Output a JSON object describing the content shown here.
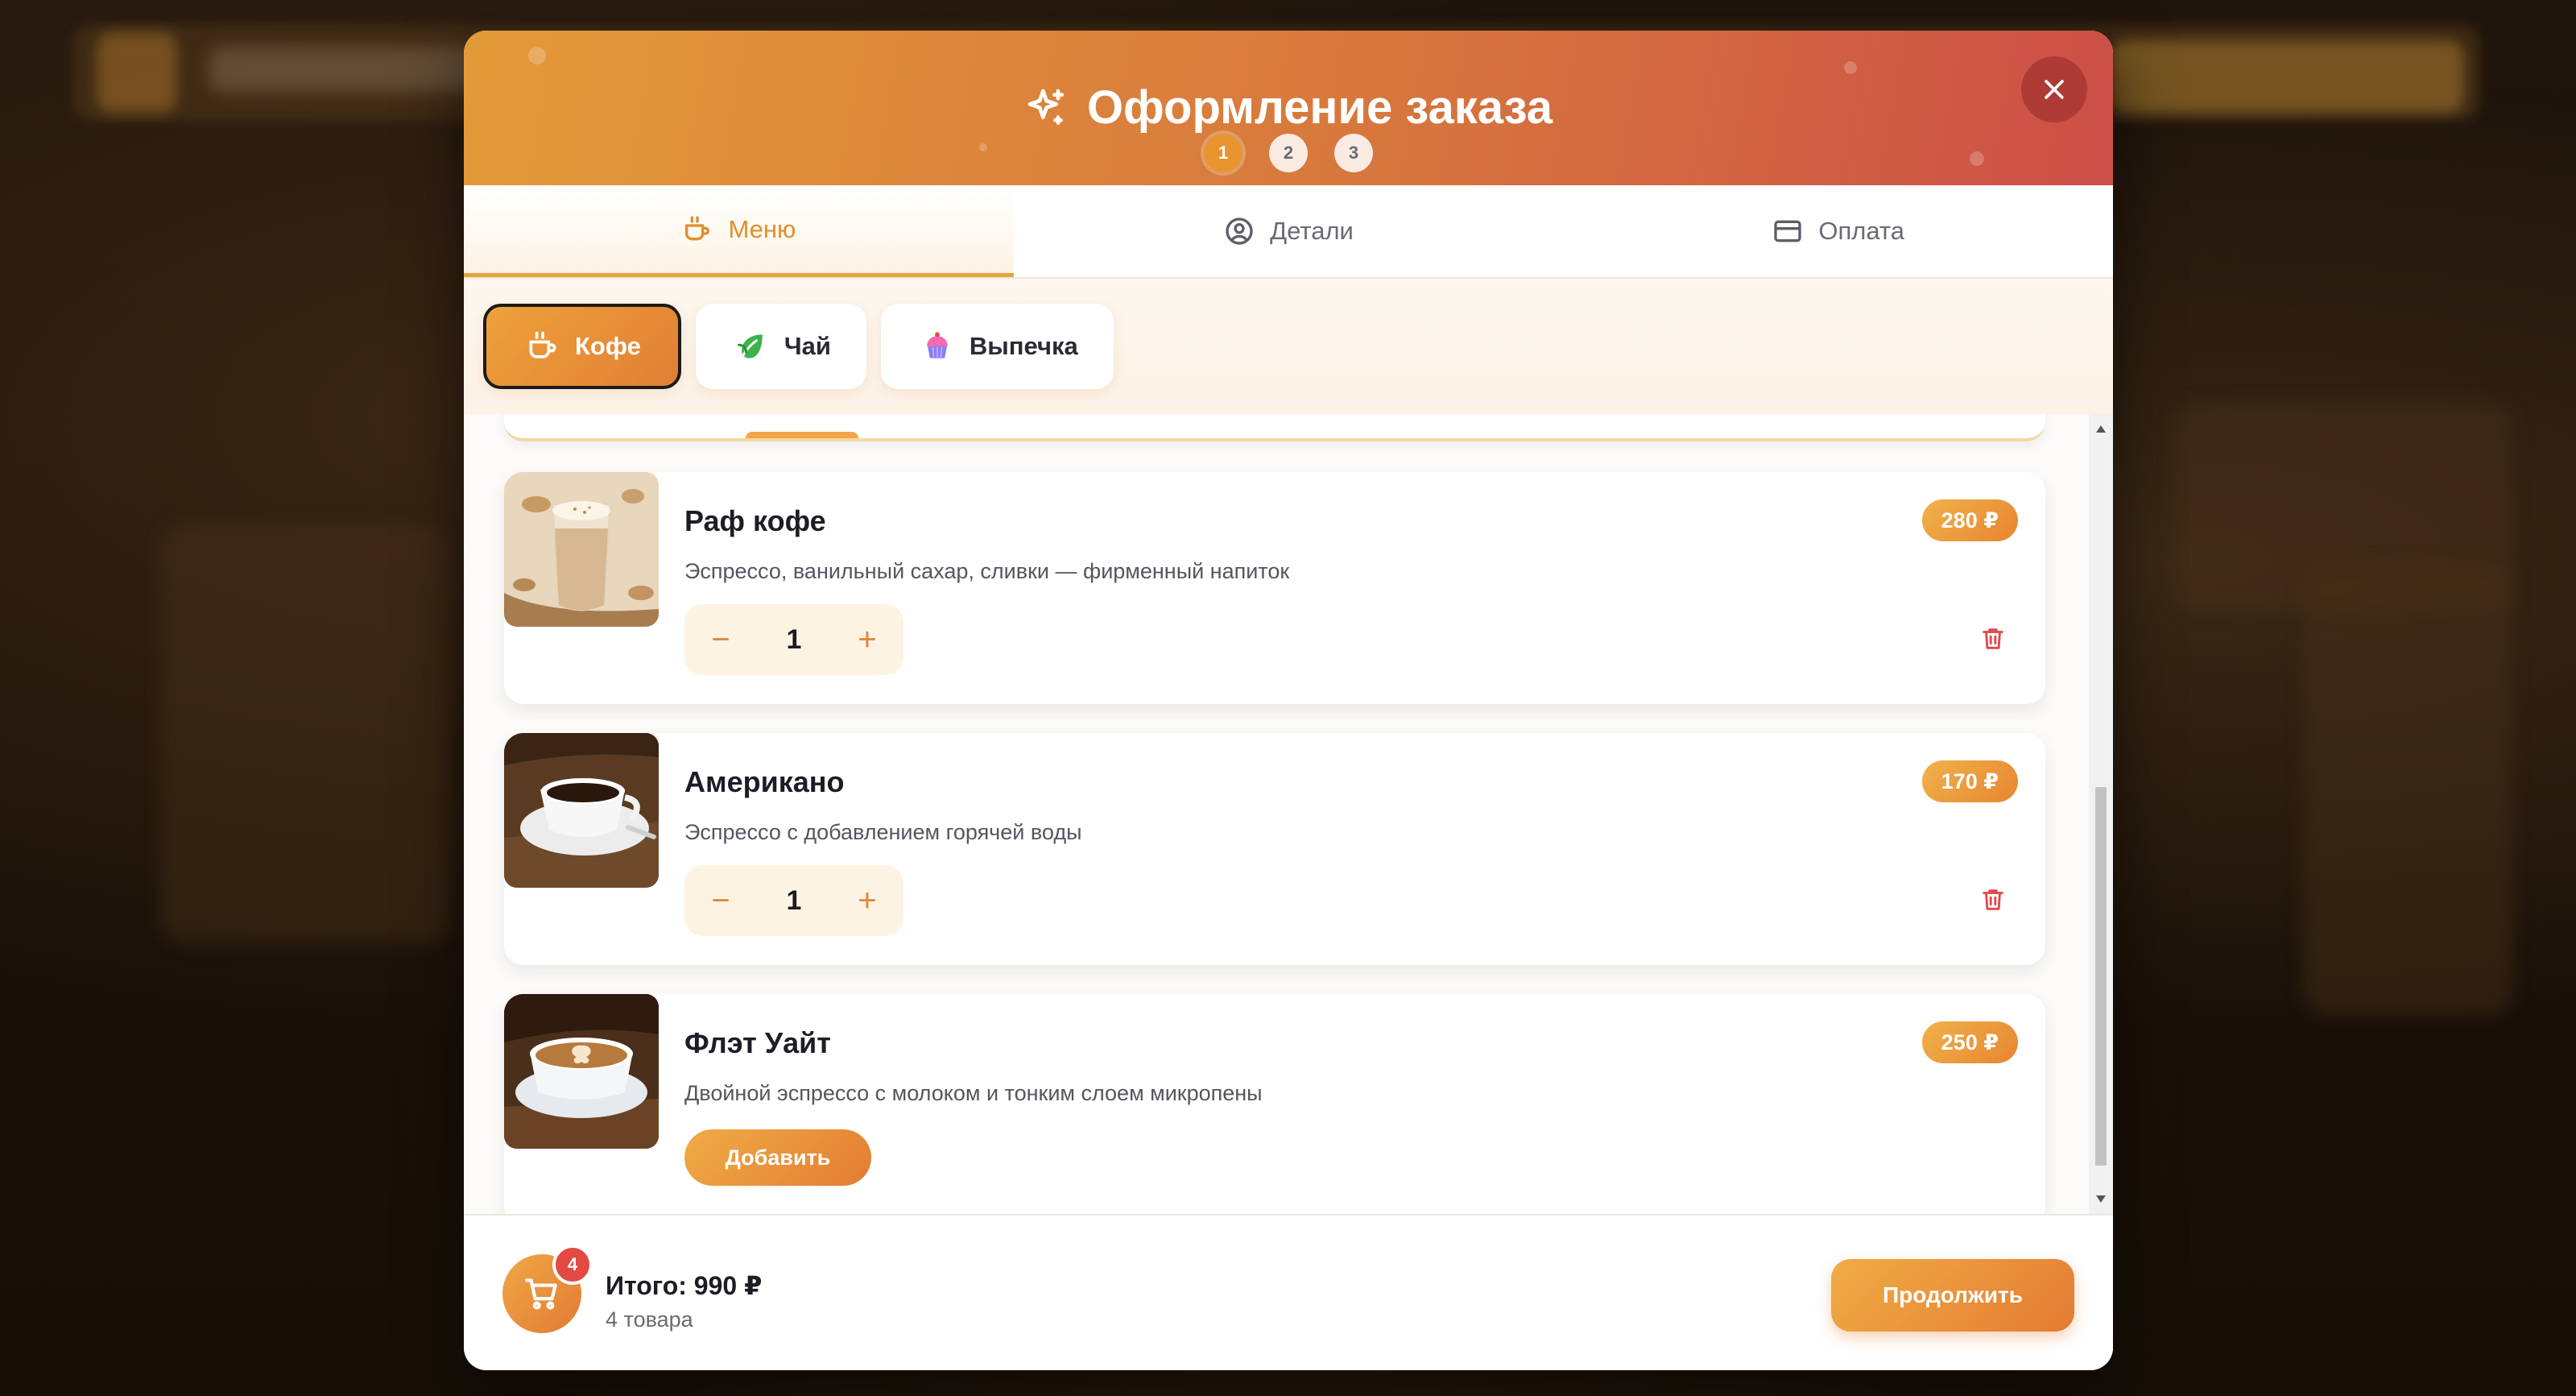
{
  "modal": {
    "title": "Оформление заказа",
    "title_icon": "sparkle-icon",
    "steps": [
      "1",
      "2",
      "3"
    ],
    "active_step": 1,
    "close_icon": "close-icon"
  },
  "tabs": [
    {
      "label": "Меню",
      "icon": "coffee-cup-icon",
      "active": true
    },
    {
      "label": "Детали",
      "icon": "user-circle-icon",
      "active": false
    },
    {
      "label": "Оплата",
      "icon": "credit-card-icon",
      "active": false
    }
  ],
  "categories": [
    {
      "label": "Кофе",
      "icon": "coffee-cup-icon",
      "active": true
    },
    {
      "label": "Чай",
      "icon": "leaf-icon",
      "active": false
    },
    {
      "label": "Выпечка",
      "icon": "cupcake-icon",
      "active": false
    }
  ],
  "items": [
    {
      "name": "Раф кофе",
      "description": "Эспрессо, ванильный сахар, сливки — фирменный напиток",
      "price": "280 ₽",
      "quantity": "1",
      "in_cart": true
    },
    {
      "name": "Американо",
      "description": "Эспрессо с добавлением горячей воды",
      "price": "170 ₽",
      "quantity": "1",
      "in_cart": true
    },
    {
      "name": "Флэт Уайт",
      "description": "Двойной эспрессо с молоком и тонким слоем микропены",
      "price": "250 ₽",
      "add_label": "Добавить",
      "in_cart": false
    }
  ],
  "stepper": {
    "minus": "−",
    "plus": "+"
  },
  "footer": {
    "cart_count": "4",
    "total": "Итого: 990 ₽",
    "items_count": "4 товара",
    "continue_label": "Продолжить"
  },
  "colors": {
    "accent": "#e8952f",
    "header_start": "#e39a38",
    "header_end": "#cc4f47",
    "badge": "#e24a43"
  }
}
